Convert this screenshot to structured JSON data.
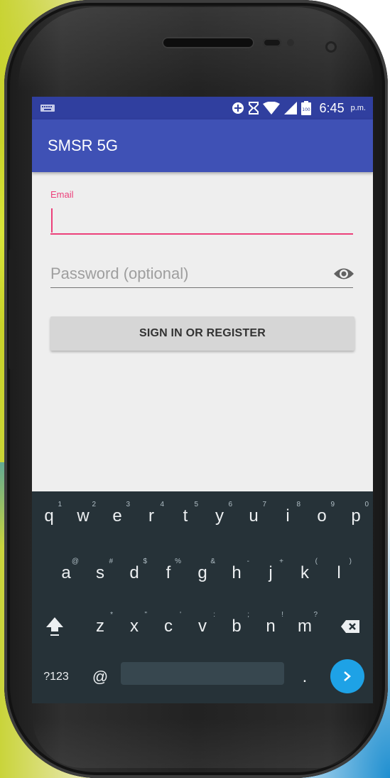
{
  "status_bar": {
    "time": "6:45",
    "ampm": "p.m.",
    "battery_level": "100",
    "icons": [
      "keyboard-icon",
      "data-saver-icon",
      "hourglass-icon",
      "wifi-icon",
      "cell-signal-icon",
      "battery-icon"
    ]
  },
  "app_bar": {
    "title": "SMSR 5G"
  },
  "form": {
    "email_label": "Email",
    "email_value": "",
    "password_placeholder": "Password (optional)",
    "sign_in_label": "SIGN IN OR REGISTER"
  },
  "keyboard": {
    "row1": [
      {
        "k": "q",
        "h": "1"
      },
      {
        "k": "w",
        "h": "2"
      },
      {
        "k": "e",
        "h": "3"
      },
      {
        "k": "r",
        "h": "4"
      },
      {
        "k": "t",
        "h": "5"
      },
      {
        "k": "y",
        "h": "6"
      },
      {
        "k": "u",
        "h": "7"
      },
      {
        "k": "i",
        "h": "8"
      },
      {
        "k": "o",
        "h": "9"
      },
      {
        "k": "p",
        "h": "0"
      }
    ],
    "row2": [
      {
        "k": "a",
        "h": "@"
      },
      {
        "k": "s",
        "h": "#"
      },
      {
        "k": "d",
        "h": "$"
      },
      {
        "k": "f",
        "h": "%"
      },
      {
        "k": "g",
        "h": "&"
      },
      {
        "k": "h",
        "h": "-"
      },
      {
        "k": "j",
        "h": "+"
      },
      {
        "k": "k",
        "h": "("
      },
      {
        "k": "l",
        "h": ")"
      }
    ],
    "row3": [
      {
        "k": "z",
        "h": "*"
      },
      {
        "k": "x",
        "h": "\""
      },
      {
        "k": "c",
        "h": "'"
      },
      {
        "k": "v",
        "h": ":"
      },
      {
        "k": "b",
        "h": ";"
      },
      {
        "k": "n",
        "h": "!"
      },
      {
        "k": "m",
        "h": "?"
      }
    ],
    "symbols_label": "?123",
    "at_label": "@",
    "period_label": "."
  },
  "colors": {
    "status_bar": "#303f9f",
    "app_bar": "#3f51b5",
    "accent": "#ec407a",
    "keyboard_bg": "#263238",
    "enter_key": "#1ea2e6"
  }
}
